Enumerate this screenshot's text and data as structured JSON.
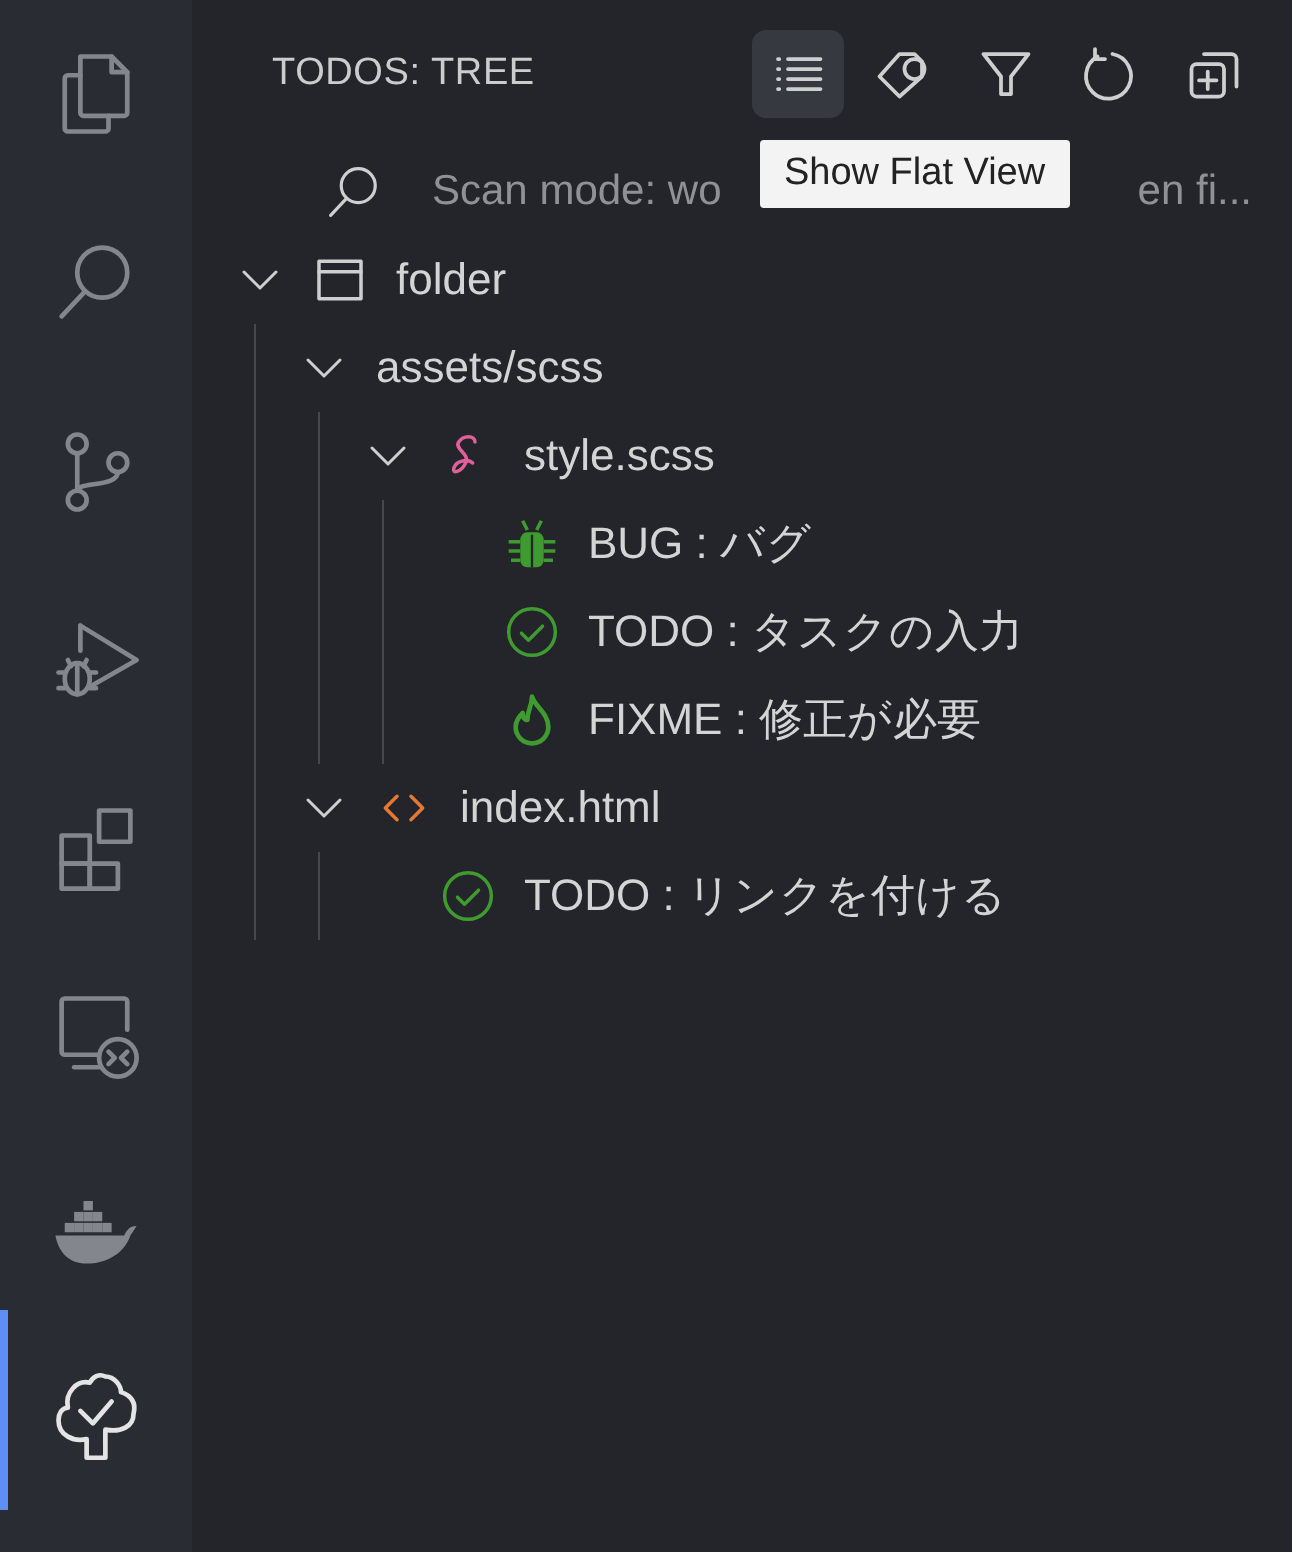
{
  "activity_bar": {
    "items": [
      {
        "kind": "explorer",
        "selected": false
      },
      {
        "kind": "search",
        "selected": false
      },
      {
        "kind": "source-control",
        "selected": false
      },
      {
        "kind": "run-debug",
        "selected": false
      },
      {
        "kind": "extensions",
        "selected": false
      },
      {
        "kind": "remote",
        "selected": false
      },
      {
        "kind": "docker",
        "selected": false
      },
      {
        "kind": "todo-tree",
        "selected": true
      }
    ]
  },
  "panel": {
    "title": "TODOS: TREE",
    "toolbar": [
      {
        "kind": "flat-view",
        "hovered": true
      },
      {
        "kind": "tags",
        "hovered": false
      },
      {
        "kind": "filter",
        "hovered": false
      },
      {
        "kind": "refresh",
        "hovered": false
      },
      {
        "kind": "expand",
        "hovered": false
      }
    ],
    "tooltip": "Show Flat View",
    "scan_mode": {
      "visible_start": "Scan mode: wo",
      "visible_end": "en fi..."
    },
    "tree": [
      {
        "kind": "workspace",
        "label": "folder",
        "expanded": true,
        "children": [
          {
            "kind": "directory",
            "label": "assets/scss",
            "expanded": true,
            "children": [
              {
                "kind": "sass-file",
                "label": "style.scss",
                "expanded": true,
                "children": [
                  {
                    "kind": "bug",
                    "label": "BUG : バグ"
                  },
                  {
                    "kind": "todo",
                    "label": "TODO : タスクの入力"
                  },
                  {
                    "kind": "fixme",
                    "label": "FIXME : 修正が必要"
                  }
                ]
              }
            ]
          },
          {
            "kind": "html-file",
            "label": "index.html",
            "expanded": true,
            "children": [
              {
                "kind": "todo",
                "label": "TODO : リンクを付ける"
              }
            ]
          }
        ]
      }
    ]
  }
}
